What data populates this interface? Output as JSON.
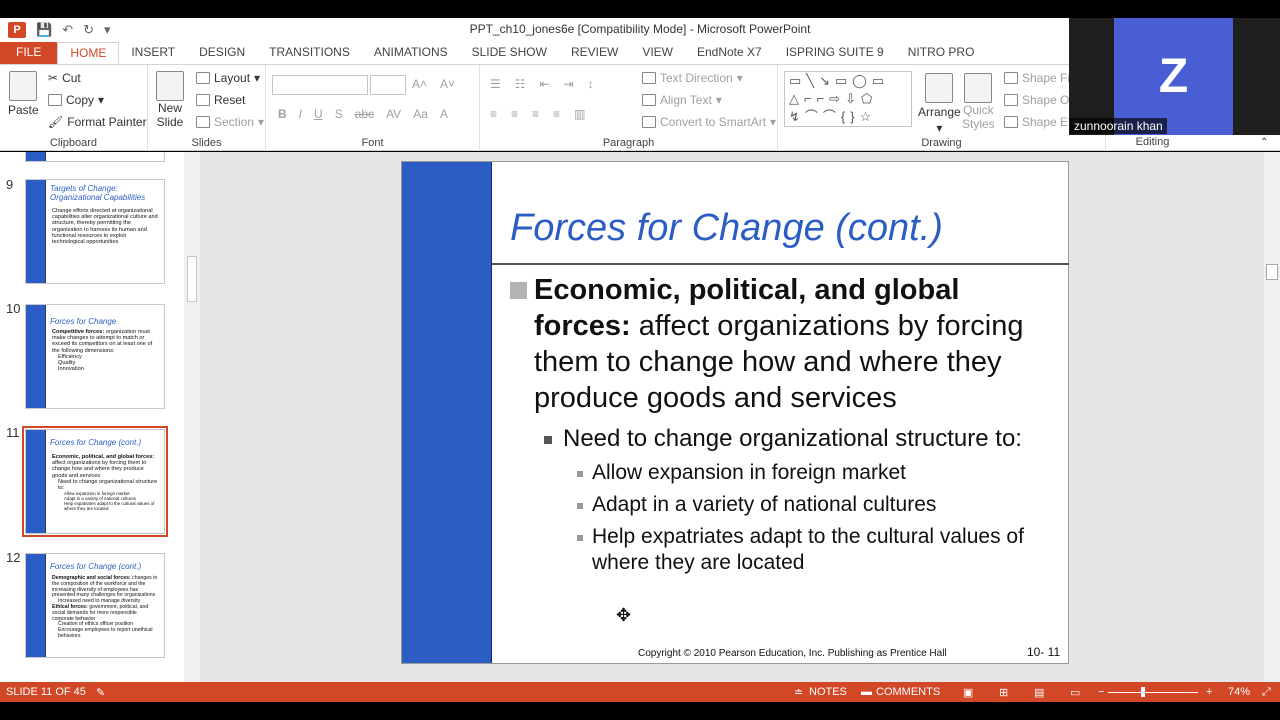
{
  "window": {
    "title": "PPT_ch10_jones6e [Compatibility Mode] - Microsoft PowerPoint",
    "qat": [
      "save-icon",
      "undo-icon",
      "redo-icon",
      "customize-icon"
    ]
  },
  "tabs": [
    "FILE",
    "HOME",
    "INSERT",
    "DESIGN",
    "TRANSITIONS",
    "ANIMATIONS",
    "SLIDE SHOW",
    "REVIEW",
    "VIEW",
    "EndNote X7",
    "ISPRING SUITE 9",
    "NITRO PRO"
  ],
  "ribbon": {
    "clipboard": {
      "label": "Clipboard",
      "paste": "Paste",
      "cut": "Cut",
      "copy": "Copy",
      "format_painter": "Format Painter"
    },
    "slides": {
      "label": "Slides",
      "new_slide_1": "New",
      "new_slide_2": "Slide",
      "layout": "Layout",
      "reset": "Reset",
      "section": "Section"
    },
    "font": {
      "label": "Font",
      "bold": "B",
      "italic": "I",
      "underline": "U",
      "strike": "S",
      "shadow": "abc",
      "spacing": "AV",
      "case": "Aa",
      "color": "A"
    },
    "paragraph": {
      "label": "Paragraph",
      "text_direction": "Text Direction",
      "align_text": "Align Text",
      "convert": "Convert to SmartArt"
    },
    "drawing": {
      "label": "Drawing",
      "arrange": "Arrange",
      "quick_styles_1": "Quick",
      "quick_styles_2": "Styles",
      "shape_fill": "Shape Fill",
      "shape_outline": "Shape Ou",
      "shape_effects": "Shape Eff",
      "shapes_row1": "▭╲↘▭◯▭",
      "shapes_row2": "△⌐⌐⇨⇩⬠",
      "shapes_row3": "↯⌒⌒{}☆"
    },
    "editing": {
      "label": "Editing"
    }
  },
  "video": {
    "initial": "Z",
    "name": "zunnoorain khan"
  },
  "thumbnails": [
    {
      "num": "9",
      "title": "Targets of Change: Organizational Capabilities",
      "body": "Change efforts directed at organizational capabilities alter organizational culture and structure, thereby permitting the organization to harness its human and functional resources to exploit technological opportunities"
    },
    {
      "num": "10",
      "title": "Forces for Change",
      "bold": "Competitive forces:",
      "body": " organization must make changes to attempt to match or exceed its competitors on at least one of the following dimensions:",
      "items": [
        "Efficiency",
        "Quality",
        "Innovation"
      ]
    },
    {
      "num": "11",
      "title": "Forces for Change (cont.)",
      "bold": "Economic, political, and global forces:",
      "body": " affect organizations by forcing them to change how and where they produce goods and services",
      "items": [
        "Need to change organizational structure to:",
        "Allow expansion in foreign market",
        "Adapt in a variety of national cultures",
        "Help expatriates adapt to the cultural values of where they are located"
      ]
    },
    {
      "num": "12",
      "title": "Forces for Change (cont.)",
      "bold": "Demographic and social forces:",
      "body": " changes in the composition of the workforce and the increasing diversity of employees has presented many challenges for organizations",
      "items": [
        "Increased need to manage diversity"
      ],
      "bold2": "Ethical forces:",
      "body2": " government, political, and social demands for more responsible corporate behavior",
      "items2": [
        "Creation of ethics officer position",
        "Encourage employees to report unethical behaviors"
      ]
    }
  ],
  "slide": {
    "title": "Forces for Change (cont.)",
    "b1_bold": "Economic, political, and global forces:",
    "b1_text": " affect organizations by forcing them to change how and where they produce goods and services",
    "b2": "Need to change organizational structure to:",
    "b3": [
      "Allow expansion in foreign market",
      "Adapt in a variety of national cultures",
      "Help expatriates adapt to the cultural values of where they are located"
    ],
    "copyright": "Copyright © 2010 Pearson Education, Inc. Publishing as Prentice Hall",
    "page": "10- 11"
  },
  "status": {
    "slide_info": "SLIDE 11 OF 45",
    "notes": "NOTES",
    "comments": "COMMENTS",
    "zoom": "74%"
  }
}
